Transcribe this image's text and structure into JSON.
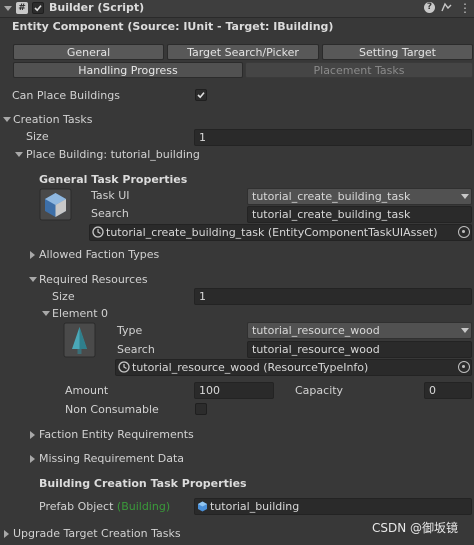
{
  "header": {
    "title": "Builder (Script)",
    "component_title": "Entity Component (Source: IUnit - Target: IBuilding)"
  },
  "tabs": [
    {
      "label": "General"
    },
    {
      "label": "Target Search/Picker"
    },
    {
      "label": "Setting Target"
    },
    {
      "label": "Handling Progress"
    },
    {
      "label": "Placement Tasks"
    }
  ],
  "fields": {
    "can_place_buildings": {
      "label": "Can Place Buildings",
      "checked": true
    },
    "creation_tasks": {
      "label": "Creation Tasks",
      "size_label": "Size",
      "size": "1"
    },
    "place_building": {
      "label": "Place Building: tutorial_building"
    },
    "general_task_props": {
      "title": "General Task Properties",
      "task_ui_label": "Task UI",
      "task_ui_value": "tutorial_create_building_task",
      "search_label": "Search",
      "search_value": "tutorial_create_building_task",
      "object_value": "tutorial_create_building_task (EntityComponentTaskUIAsset)"
    },
    "allowed_faction_types": {
      "label": "Allowed Faction Types"
    },
    "required_resources": {
      "label": "Required Resources",
      "size_label": "Size",
      "size": "1",
      "element_label": "Element 0",
      "type_label": "Type",
      "type_value": "tutorial_resource_wood",
      "search_label": "Search",
      "search_value": "tutorial_resource_wood",
      "object_value": "tutorial_resource_wood (ResourceTypeInfo)",
      "amount_label": "Amount",
      "amount": "100",
      "capacity_label": "Capacity",
      "capacity": "0",
      "non_consumable_label": "Non Consumable"
    },
    "faction_entity_requirements": {
      "label": "Faction Entity Requirements"
    },
    "missing_requirement_data": {
      "label": "Missing Requirement Data"
    },
    "building_creation_task_props": {
      "title": "Building Creation Task Properties",
      "prefab_label": "Prefab Object",
      "prefab_hint": "(Building)",
      "prefab_value": "tutorial_building"
    },
    "upgrade_target": {
      "label": "Upgrade Target Creation Tasks"
    }
  },
  "watermark": "CSDN @御坂镜",
  "colors": {
    "accent_hint": "#3a9a3a",
    "background": "#383838"
  }
}
